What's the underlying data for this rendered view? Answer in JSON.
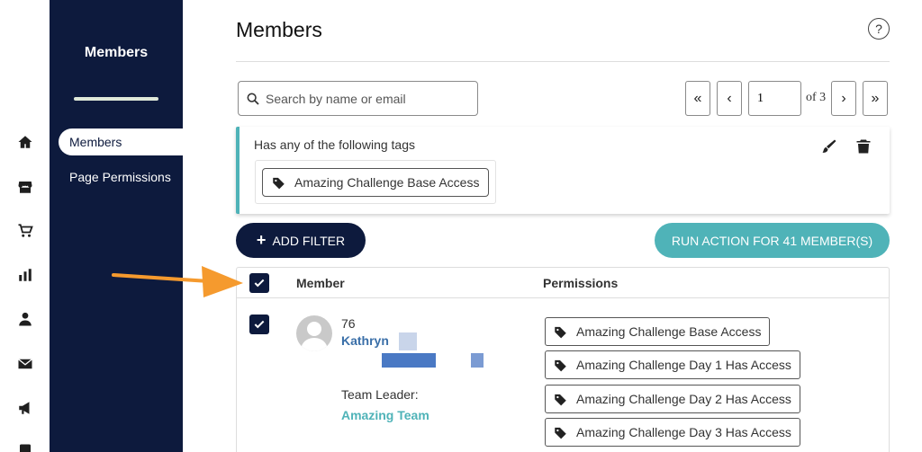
{
  "nav": {
    "title": "Members",
    "items": [
      {
        "label": "Members",
        "active": true
      },
      {
        "label": "Page Permissions",
        "active": false
      }
    ]
  },
  "rail": [
    "home-icon",
    "store-icon",
    "cart-icon",
    "bar-chart-icon",
    "person-icon",
    "mail-icon",
    "megaphone-icon",
    "book-icon"
  ],
  "header": {
    "title": "Members",
    "help": "?"
  },
  "search": {
    "placeholder": "Search by name or email"
  },
  "pagination": {
    "first": "«",
    "prev": "‹",
    "page": "1",
    "of_label": "of 3",
    "next": "›",
    "last": "»"
  },
  "filter": {
    "label": "Has any of the following tags",
    "tag": "Amazing Challenge Base Access"
  },
  "actions": {
    "add_filter": "ADD FILTER",
    "run_action": "RUN ACTION FOR 41 MEMBER(S)"
  },
  "table": {
    "headers": {
      "member": "Member",
      "permissions": "Permissions"
    },
    "rows": [
      {
        "id": "76",
        "name": "Kathryn",
        "team_label": "Team Leader:",
        "team": "Amazing Team",
        "permissions": [
          "Amazing Challenge Base Access",
          "Amazing Challenge Day 1 Has Access",
          "Amazing Challenge Day 2 Has Access",
          "Amazing Challenge Day 3 Has Access"
        ]
      }
    ]
  },
  "colors": {
    "navy": "#0d1a3d",
    "teal": "#4fb3b8",
    "arrow": "#f59a2e",
    "link": "#3a6fa8"
  }
}
